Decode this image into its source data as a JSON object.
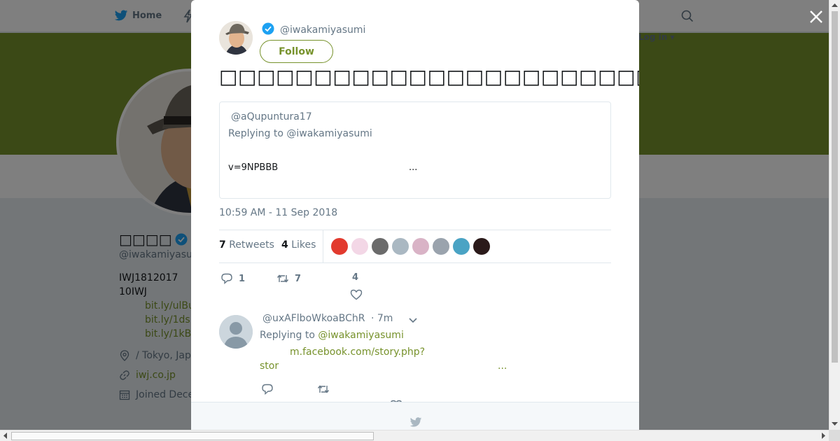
{
  "nav": {
    "home_label": "Home",
    "login_label": "Log in"
  },
  "profile": {
    "name": "□□□□",
    "handle": "@iwakamiyasumi",
    "bio_line1": "IWJ1812017",
    "bio_line2": "10IWJ",
    "bio_links": [
      "bit.ly/ulBu",
      "bit.ly/1ds",
      "bit.ly/1kB"
    ],
    "location": "/ Tokyo, Jap",
    "website": "iwj.co.jp",
    "joined": "Joined Decem"
  },
  "tweet": {
    "handle": "@iwakamiyasumi",
    "follow_label": "Follow",
    "text": "□□□□□□□□□□□□□□□□□□□□□□□□□□□□□□□□□□□□□□□□□□□□□□□□□□□",
    "timestamp": "10:59 AM - 11 Sep 2018",
    "quote": {
      "handle": "@aQupuntura17",
      "replying": "Replying to @iwakamiyasumi",
      "text": "v=9NPBBB",
      "more": "..."
    },
    "retweets_count": "7",
    "retweets_label": "Retweets",
    "likes_count": "4",
    "likes_label": "Likes",
    "likers": [
      {
        "color": "#e23a2e",
        "icon": "red-face"
      },
      {
        "color": "#f3d7e6",
        "icon": "cute-character"
      },
      {
        "color": "#6b6b6b",
        "icon": "person-photo"
      },
      {
        "color": "#aab8c2",
        "icon": "default-avatar"
      },
      {
        "color": "#d9b3c6",
        "icon": "anime-photo"
      },
      {
        "color": "#9aa3ad",
        "icon": "gray-photo"
      },
      {
        "color": "#4aa3c4",
        "icon": "blue-photo"
      },
      {
        "color": "#2b1a1a",
        "icon": "dark-photo"
      }
    ],
    "actions": {
      "replies": "1",
      "retweets": "7",
      "likes": "4"
    }
  },
  "reply": {
    "handle": "@uxAFlboWkoaBChR",
    "time": "· 7m",
    "replying_prefix": "Replying to",
    "replying_to": "@iwakamiyasumi",
    "link_line1": "m.facebook.com/story.php?",
    "link_line2": "stor",
    "more": "..."
  },
  "colors": {
    "accent": "#77922c",
    "banner": "#77922c",
    "verified": "#1da1f2"
  }
}
